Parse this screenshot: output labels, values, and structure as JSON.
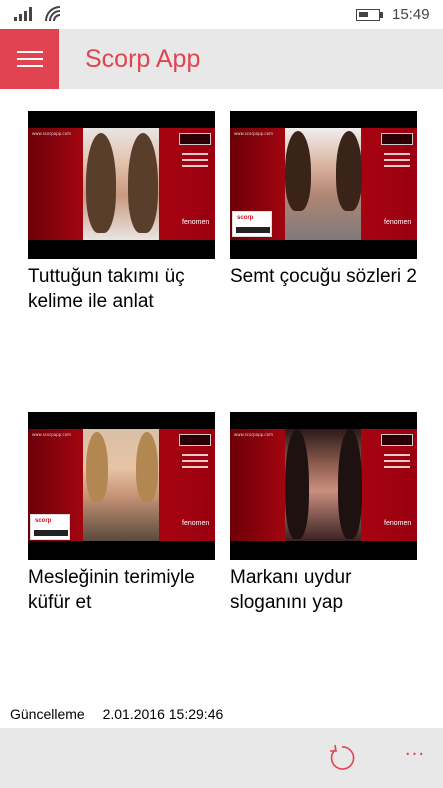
{
  "status_bar": {
    "time": "15:49"
  },
  "app_bar": {
    "title": "Scorp App",
    "accent_color": "#e14450",
    "menu_icon": "hamburger-icon"
  },
  "videos": [
    {
      "title": "Tuttuğun takımı üç kelime ile anlat",
      "thumbnail_brand": "fenomen"
    },
    {
      "title": "Semt çocuğu sözleri 2",
      "thumbnail_brand": "fenomen",
      "thumbnail_badge": "scorp"
    },
    {
      "title": "Mesleğinin terimiyle küfür et",
      "thumbnail_brand": "fenomen",
      "thumbnail_badge": "scorp"
    },
    {
      "title": "Markanı uydur sloganını yap",
      "thumbnail_brand": "fenomen"
    }
  ],
  "footer": {
    "update_label": "Güncelleme",
    "update_value": "2.01.2016 15:29:46"
  },
  "bottom_bar": {
    "refresh_icon": "refresh-icon",
    "more_icon": "more-icon",
    "more_label": "···"
  }
}
